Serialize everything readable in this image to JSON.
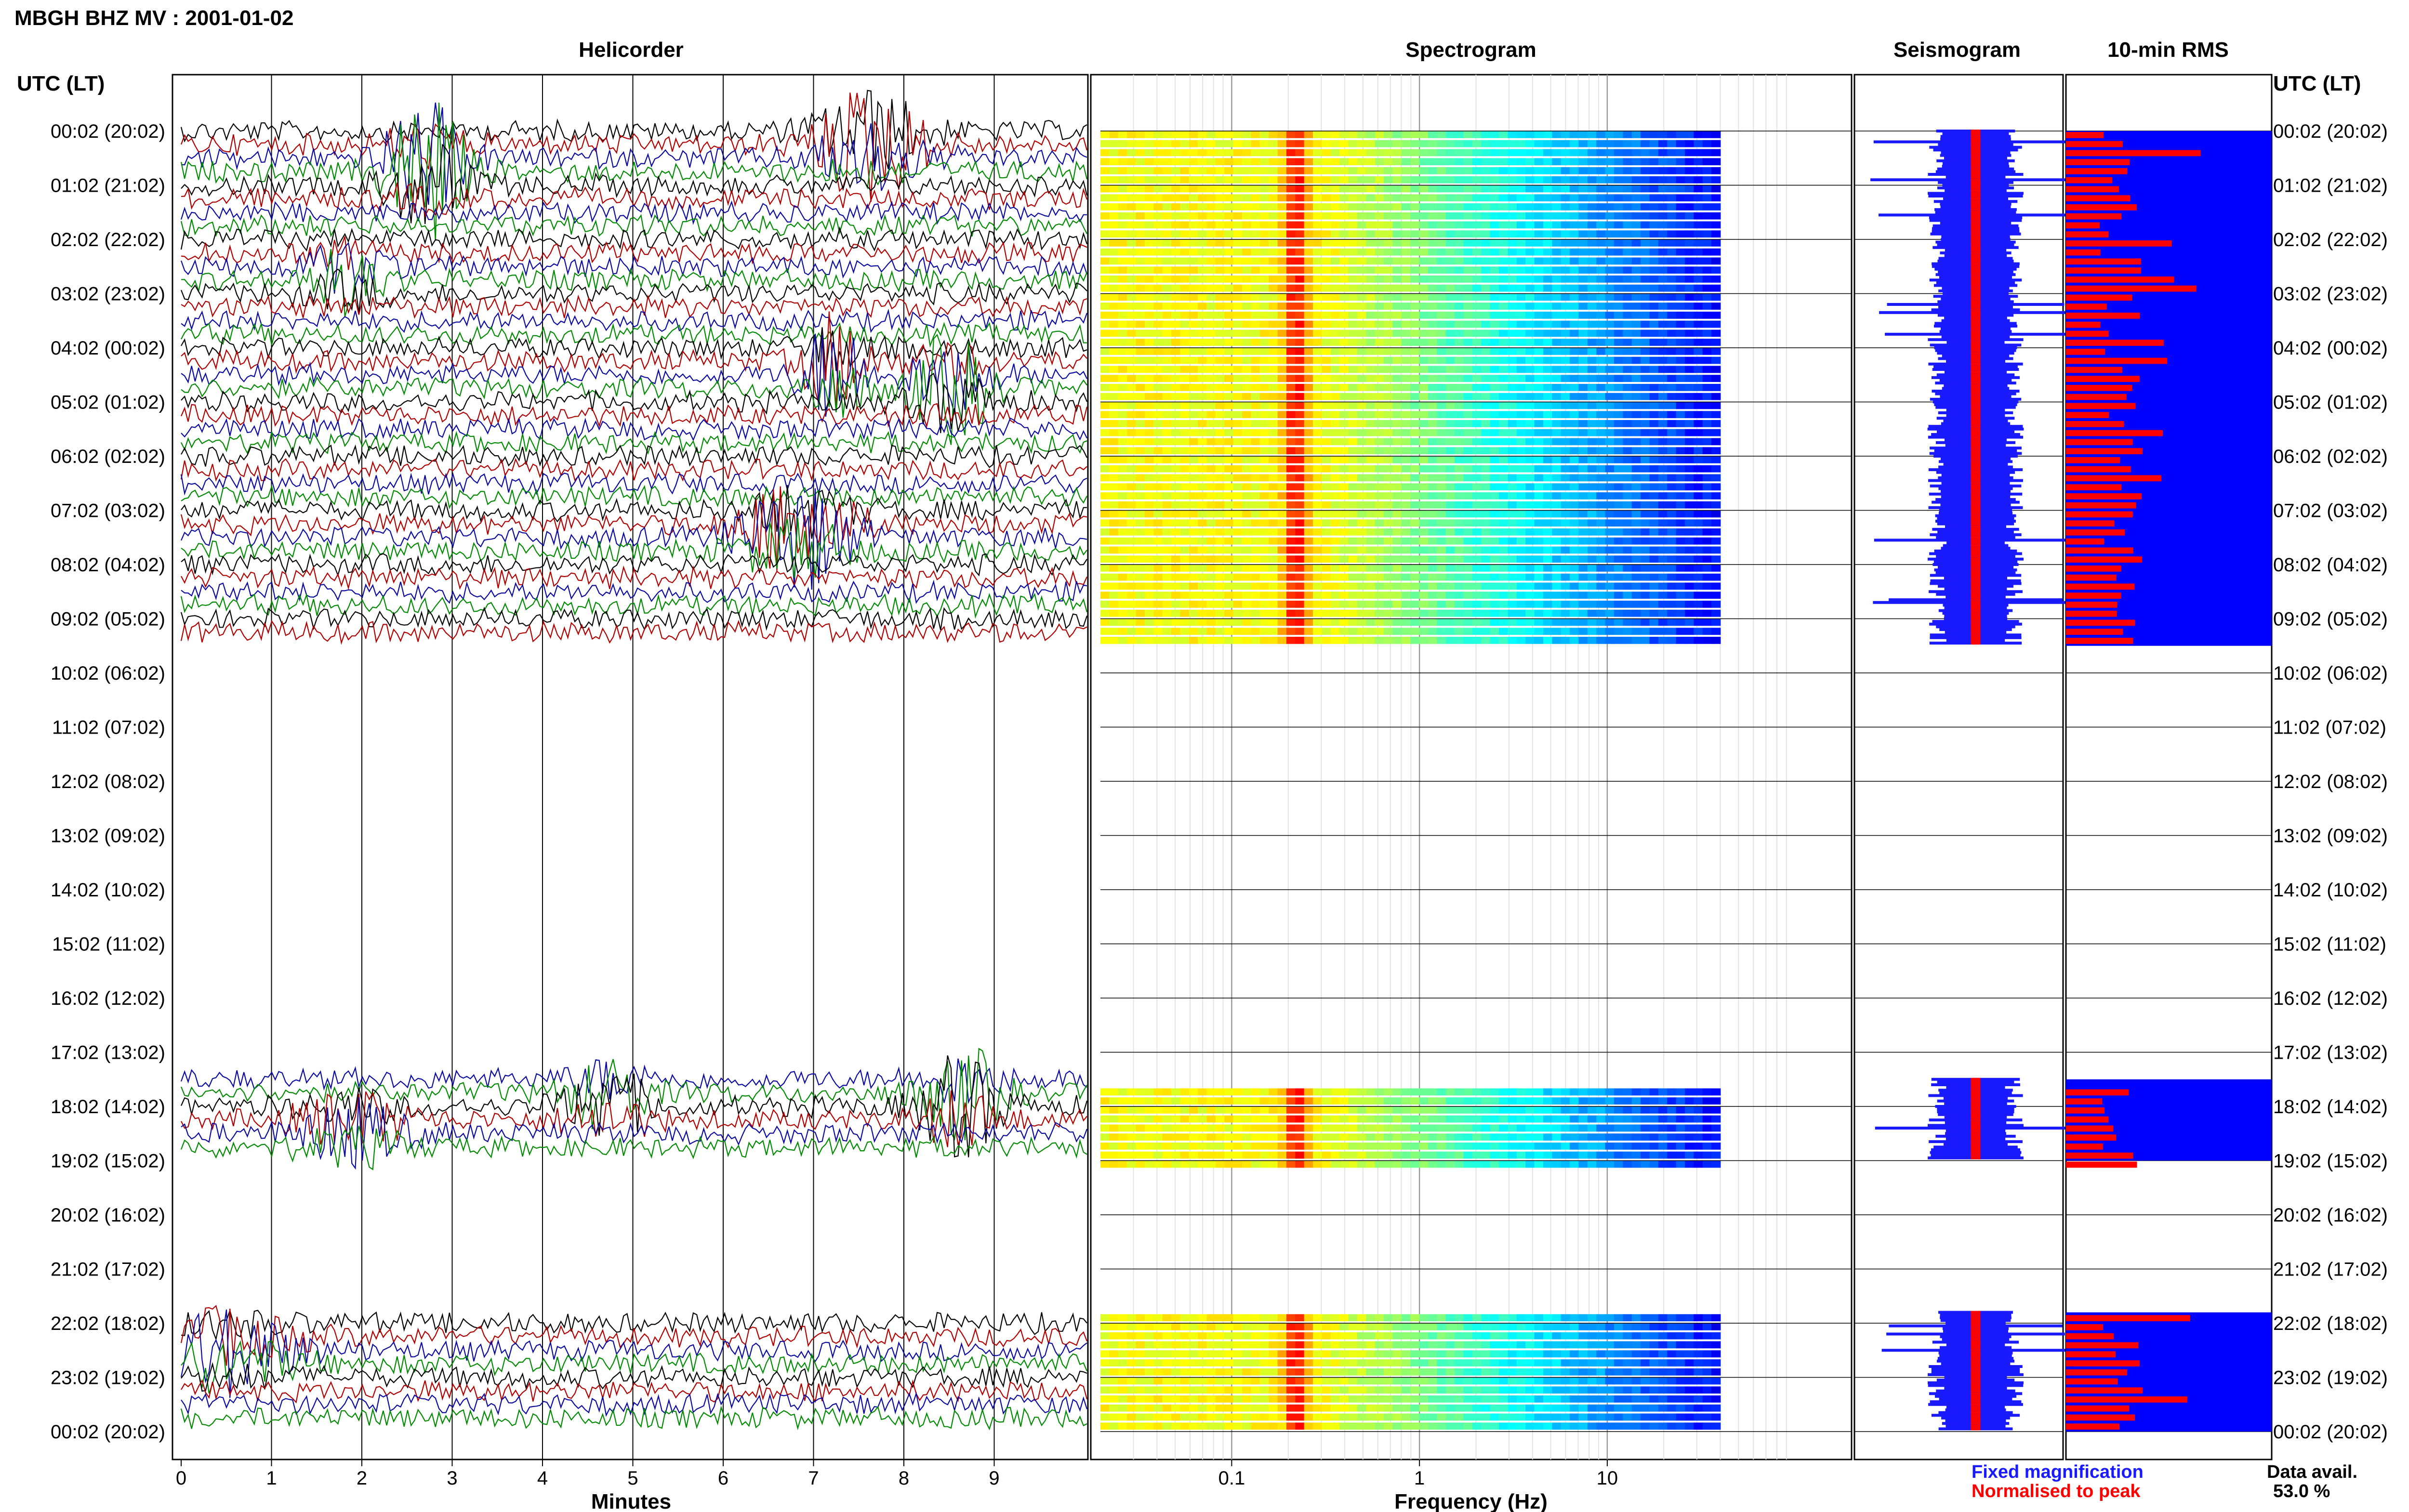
{
  "title": "MBGH BHZ MV : 2001-01-02",
  "panels": {
    "helicorder": "Helicorder",
    "spectrogram": "Spectrogram",
    "seismogram": "Seismogram",
    "rms": "10-min RMS"
  },
  "axis": {
    "utc_label": "UTC (LT)",
    "minutes_label": "Minutes",
    "frequency_label": "Frequency (Hz)",
    "minute_ticks": [
      "0",
      "1",
      "2",
      "3",
      "4",
      "5",
      "6",
      "7",
      "8",
      "9"
    ],
    "freq_ticks": [
      "0.1",
      "1",
      "10"
    ]
  },
  "hour_labels": [
    "00:02 (20:02)",
    "01:02 (21:02)",
    "02:02 (22:02)",
    "03:02 (23:02)",
    "04:02 (00:02)",
    "05:02 (01:02)",
    "06:02 (02:02)",
    "07:02 (03:02)",
    "08:02 (04:02)",
    "09:02 (05:02)",
    "10:02 (06:02)",
    "11:02 (07:02)",
    "12:02 (08:02)",
    "13:02 (09:02)",
    "14:02 (10:02)",
    "15:02 (11:02)",
    "16:02 (12:02)",
    "17:02 (13:02)",
    "18:02 (14:02)",
    "19:02 (15:02)",
    "20:02 (16:02)",
    "21:02 (17:02)",
    "22:02 (18:02)",
    "23:02 (19:02)",
    "00:02 (20:02)"
  ],
  "legend": {
    "fixed": "Fixed magnification",
    "normalised": "Normalised to peak",
    "fixed_color": "#1a1aff",
    "normalised_color": "#ff0000"
  },
  "availability": {
    "label": "Data avail.",
    "value": "53.0 %"
  },
  "chart_data": {
    "type": "heatmap",
    "station": "MBGH",
    "channel": "BHZ",
    "network": "MV",
    "date": "2001-01-02",
    "minutes_range": [
      0,
      10
    ],
    "frequency_range_hz": [
      0.02,
      40
    ],
    "frequency_scale": "log",
    "data_segments_utc_hours": [
      [
        0,
        9.5
      ],
      [
        17.5,
        19
      ],
      [
        21.8,
        24
      ]
    ],
    "trace_colors": [
      "#000000",
      "#b00000",
      "#0a0aa0",
      "#008a00"
    ],
    "rms_color": "#0000ff",
    "rms_bar_color": "#ff0000",
    "spectral_peak_hz": 0.22
  }
}
